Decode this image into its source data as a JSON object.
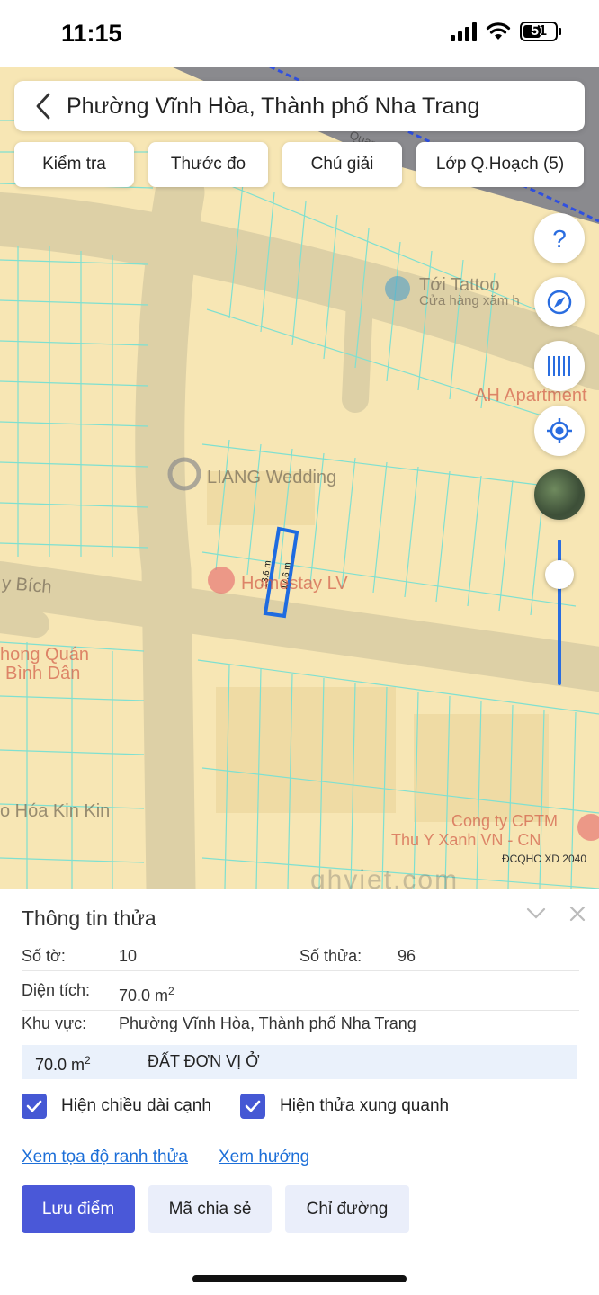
{
  "status_bar": {
    "time": "11:15",
    "battery_level": "51"
  },
  "header": {
    "title": "Phường Vĩnh Hòa, Thành phố Nha Trang"
  },
  "toolbar": {
    "check": "Kiểm tra",
    "measure": "Thước đo",
    "legend": "Chú giải",
    "planning_layers": "Lớp Q.Hoạch (5)"
  },
  "map": {
    "labels": {
      "tattoo": "Tới Tattoo",
      "tattoo_sub": "Cửa hàng xăm h",
      "ah_apartment": "AH Apartment",
      "liang": "LIANG Wedding",
      "homestay": "Homestay LV",
      "bich": "y Bích",
      "quan1": "hong Quán",
      "quan2": "Bình Dân",
      "kinkin": "o Hóa Kin Kin",
      "cty1": "Cong ty CPTM",
      "cty2": "Thu Y Xanh VN - CN",
      "quang": "Quang"
    },
    "edge_left": "13.6 m",
    "edge_right": "17.6 m",
    "credit": "ĐCQHC XD 2040",
    "watermark": "qhviet.com"
  },
  "panel": {
    "title": "Thông tin thửa",
    "sheet_label": "Số tờ:",
    "sheet_value": "10",
    "parcel_label": "Số thửa:",
    "parcel_value": "96",
    "area_label": "Diện tích:",
    "area_value": "70.0 m",
    "area_unit_sup": "2",
    "region_label": "Khu vực:",
    "region_value": "Phường Vĩnh Hòa, Thành phố Nha Trang",
    "landuse_area": "70.0 m",
    "landuse_unit_sup": "2",
    "landuse_type": "ĐẤT ĐƠN VỊ Ở",
    "show_edge_lengths": "Hiện chiều dài cạnh",
    "show_neighbors": "Hiện thửa xung quanh",
    "view_coords": "Xem tọa độ ranh thửa",
    "view_direction": "Xem hướng",
    "save_point": "Lưu điểm",
    "share_code": "Mã chia sẻ",
    "directions": "Chỉ đường"
  },
  "colors": {
    "accent": "#4a58d8",
    "map_bg": "#f7e6b4",
    "parcel_line": "#7fe0d0",
    "selected_parcel": "#1e6be0",
    "link": "#1d6fd8"
  }
}
